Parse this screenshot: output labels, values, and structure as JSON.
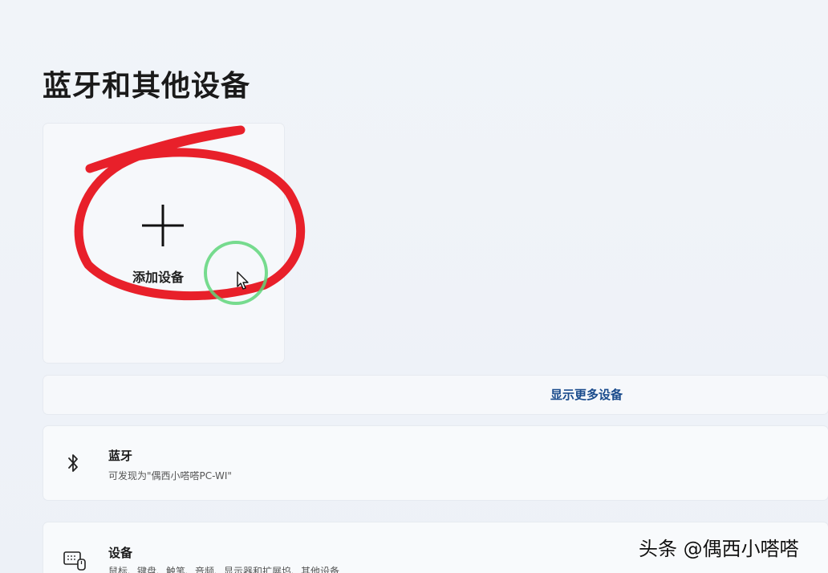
{
  "page": {
    "title": "蓝牙和其他设备"
  },
  "add_device": {
    "label": "添加设备",
    "icon": "plus-icon"
  },
  "show_more": {
    "label": "显示更多设备"
  },
  "bluetooth": {
    "title": "蓝牙",
    "subtitle": "可发现为\"偶西小嗒嗒PC-WI\"",
    "icon": "bluetooth-icon"
  },
  "devices": {
    "title": "设备",
    "subtitle": "鼠标、键盘、触笔、音频、显示器和扩展坞、其他设备",
    "icon": "devices-icon"
  },
  "watermark": {
    "text": "头条 @偶西小嗒嗒"
  },
  "colors": {
    "annotation_red": "#e8202a",
    "annotation_green": "#5fd67a",
    "link_blue": "#1a4b8c",
    "background": "#eef2f8"
  }
}
